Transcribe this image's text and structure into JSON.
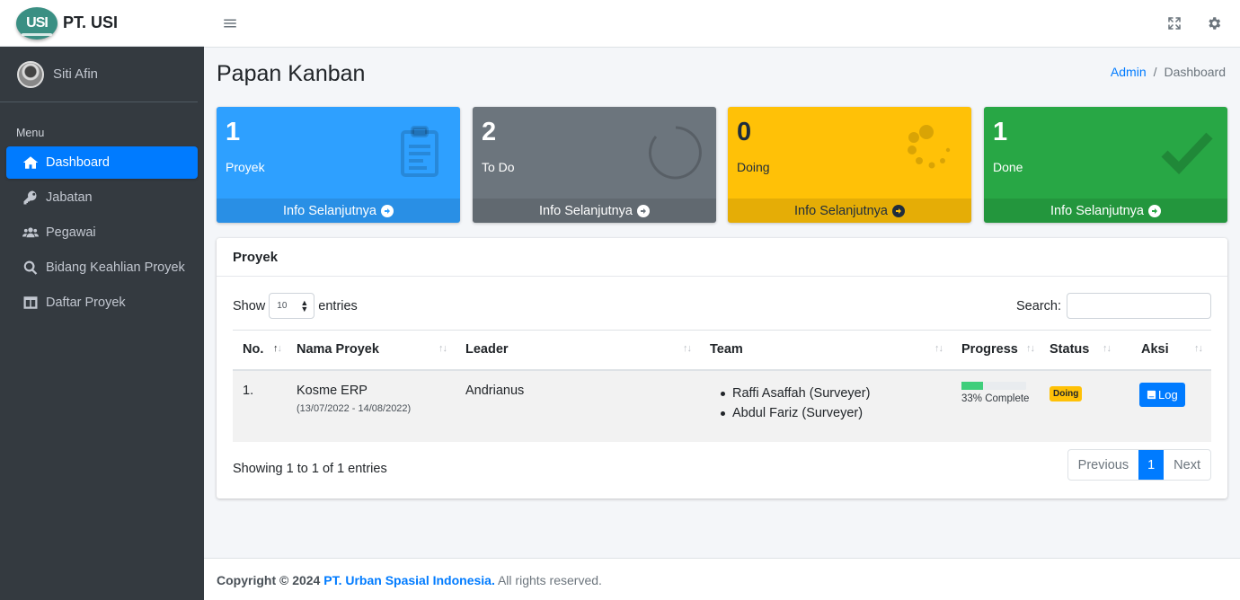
{
  "brand": {
    "logo_text": "USI",
    "name": "PT. USI"
  },
  "user": {
    "name": "Siti Afin"
  },
  "sidebar": {
    "menu_header": "Menu",
    "items": [
      {
        "label": "Dashboard",
        "icon": "home-icon",
        "active": true
      },
      {
        "label": "Jabatan",
        "icon": "key-icon"
      },
      {
        "label": "Pegawai",
        "icon": "users-icon"
      },
      {
        "label": "Bidang Keahlian Proyek",
        "icon": "search-icon"
      },
      {
        "label": "Daftar Proyek",
        "icon": "columns-icon"
      }
    ]
  },
  "topbar": {
    "menu_icon": "hamburger-icon",
    "fullscreen_icon": "expand-icon",
    "settings_icon": "gear-icon"
  },
  "page": {
    "title": "Papan Kanban"
  },
  "breadcrumb": {
    "home": "Admin",
    "separator": "/",
    "current": "Dashboard"
  },
  "stat_boxes": [
    {
      "value": "1",
      "label": "Proyek",
      "link": "Info Selanjutnya",
      "color": "#2ea0ff",
      "icon": "clipboard-icon"
    },
    {
      "value": "2",
      "label": "To Do",
      "link": "Info Selanjutnya",
      "color": "#6c757d",
      "icon": "circle-notch-icon"
    },
    {
      "value": "0",
      "label": "Doing",
      "link": "Info Selanjutnya",
      "color": "#ffc107",
      "icon": "spinner-icon"
    },
    {
      "value": "1",
      "label": "Done",
      "link": "Info Selanjutnya",
      "color": "#28a745",
      "icon": "check-icon"
    }
  ],
  "card": {
    "title": "Proyek",
    "show_label": "Show",
    "entries_value": "10",
    "entries_label": "entries",
    "search_label": "Search:",
    "search_value": "",
    "columns": [
      "No.",
      "Nama Proyek",
      "Leader",
      "Team",
      "Progress",
      "Status",
      "Aksi"
    ],
    "rows": [
      {
        "no": "1.",
        "name": "Kosme ERP",
        "dates": "(13/07/2022 - 14/08/2022)",
        "leader": "Andrianus",
        "team": [
          "Raffi Asaffah (Surveyer)",
          "Abdul Fariz (Surveyer)"
        ],
        "progress": 0.33,
        "progress_text": "33% Complete",
        "status": "Doing",
        "action": "Log"
      }
    ],
    "info": "Showing 1 to 1 of 1 entries",
    "pager": {
      "prev": "Previous",
      "current": "1",
      "next": "Next"
    }
  },
  "footer": {
    "copyright": "Copyright © 2024",
    "company": "PT. Urban Spasial Indonesia.",
    "rights": "All rights reserved."
  },
  "colors": {
    "primary": "#007bff",
    "sidebar": "#343a40",
    "success": "#28a745",
    "warning": "#ffc107",
    "info": "#2ea0ff"
  }
}
